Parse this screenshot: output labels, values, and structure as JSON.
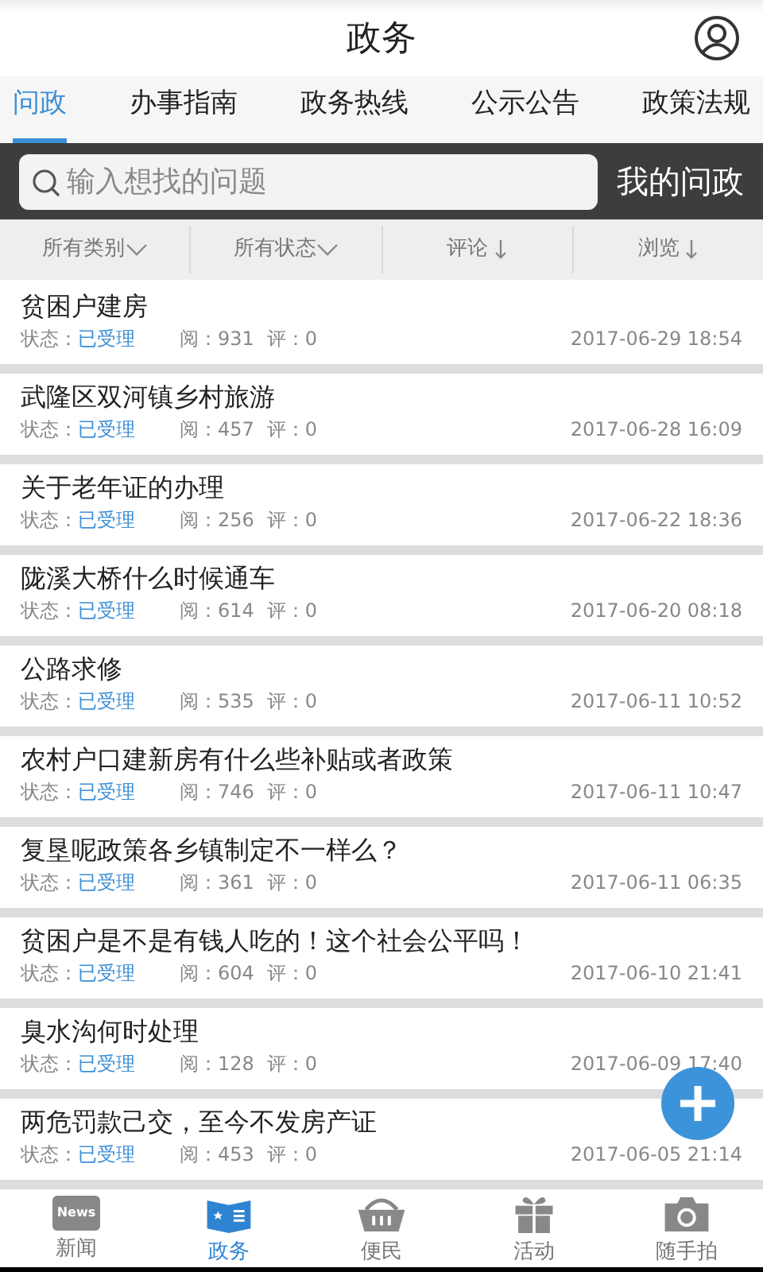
{
  "header": {
    "title": "政务"
  },
  "tabs": [
    {
      "label": "问政",
      "selected": true
    },
    {
      "label": "办事指南",
      "selected": false
    },
    {
      "label": "政务热线",
      "selected": false
    },
    {
      "label": "公示公告",
      "selected": false
    },
    {
      "label": "政策法规",
      "selected": false
    }
  ],
  "search": {
    "placeholder": "输入想找的问题",
    "button": "我的问政"
  },
  "filters": [
    {
      "label": "所有类别",
      "kind": "dropdown"
    },
    {
      "label": "所有状态",
      "kind": "dropdown"
    },
    {
      "label": "评论",
      "kind": "sort"
    },
    {
      "label": "浏览",
      "kind": "sort"
    }
  ],
  "posts": [
    {
      "title": "贫困户建房",
      "status_label": "状态：",
      "status": "已受理",
      "views": "阅：931",
      "comments": "评：0",
      "time": "2017-06-29 18:54"
    },
    {
      "title": "武隆区双河镇乡村旅游",
      "status_label": "状态：",
      "status": "已受理",
      "views": "阅：457",
      "comments": "评：0",
      "time": "2017-06-28 16:09"
    },
    {
      "title": "关于老年证的办理",
      "status_label": "状态：",
      "status": "已受理",
      "views": "阅：256",
      "comments": "评：0",
      "time": "2017-06-22 18:36"
    },
    {
      "title": "陇溪大桥什么时候通车",
      "status_label": "状态：",
      "status": "已受理",
      "views": "阅：614",
      "comments": "评：0",
      "time": "2017-06-20 08:18"
    },
    {
      "title": "公路求修",
      "status_label": "状态：",
      "status": "已受理",
      "views": "阅：535",
      "comments": "评：0",
      "time": "2017-06-11 10:52"
    },
    {
      "title": "农村户口建新房有什么些补贴或者政策",
      "status_label": "状态：",
      "status": "已受理",
      "views": "阅：746",
      "comments": "评：0",
      "time": "2017-06-11 10:47"
    },
    {
      "title": "复垦呢政策各乡镇制定不一样么？",
      "status_label": "状态：",
      "status": "已受理",
      "views": "阅：361",
      "comments": "评：0",
      "time": "2017-06-11 06:35"
    },
    {
      "title": "贫困户是不是有钱人吃的！这个社会公平吗！",
      "status_label": "状态：",
      "status": "已受理",
      "views": "阅：604",
      "comments": "评：0",
      "time": "2017-06-10 21:41"
    },
    {
      "title": "臭水沟何时处理",
      "status_label": "状态：",
      "status": "已受理",
      "views": "阅：128",
      "comments": "评：0",
      "time": "2017-06-09 17:40"
    },
    {
      "title": "两危罚款己交，至今不发房产证",
      "status_label": "状态：",
      "status": "已受理",
      "views": "阅：453",
      "comments": "评：0",
      "time": "2017-06-05 21:14"
    }
  ],
  "bottom_nav": [
    {
      "label": "新闻",
      "kind": "news",
      "icon_text": "News",
      "selected": false
    },
    {
      "label": "政务",
      "kind": "gov",
      "selected": true
    },
    {
      "label": "便民",
      "kind": "basket",
      "selected": false
    },
    {
      "label": "活动",
      "kind": "gift",
      "selected": false
    },
    {
      "label": "随手拍",
      "kind": "camera",
      "selected": false
    }
  ]
}
